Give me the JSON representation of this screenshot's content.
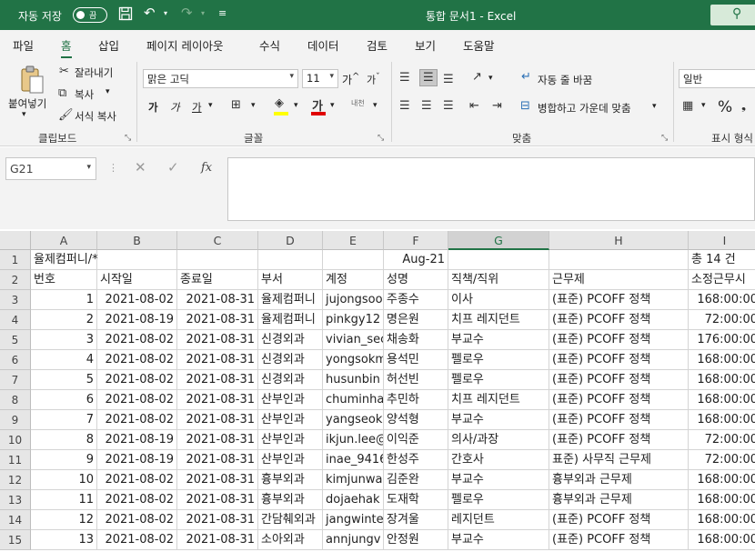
{
  "titlebar": {
    "autosave_label": "자동 저장",
    "autosave_state": "끔",
    "window_title": "통합 문서1  -  Excel"
  },
  "menu_tabs": [
    "파일",
    "홈",
    "삽입",
    "페이지 레이아웃",
    "수식",
    "데이터",
    "검토",
    "보기",
    "도움말"
  ],
  "ribbon": {
    "clipboard": {
      "paste": "붙여넣기",
      "cut": "잘라내기",
      "copy": "복사",
      "format_painter": "서식 복사",
      "group": "클립보드"
    },
    "font": {
      "name": "맑은 고딕",
      "size": "11",
      "bold": "가",
      "italic": "가",
      "underline": "가",
      "grow": "가",
      "shrink": "가",
      "phonetic": "내천",
      "group": "글꼴"
    },
    "alignment": {
      "wrap": "자동 줄 바꿈",
      "merge": "병합하고 가운데 맞춤",
      "group": "맞춤"
    },
    "number": {
      "format": "일반",
      "percent": "%",
      "group": "표시 형식"
    }
  },
  "formula_bar": {
    "name_box": "G21",
    "value": ""
  },
  "sheet": {
    "columns": [
      "A",
      "B",
      "C",
      "D",
      "E",
      "F",
      "G",
      "H",
      "I"
    ],
    "selected_column": "G",
    "row1": {
      "A": "율제컴퍼니/*",
      "F": "Aug-21",
      "I": "총 14 건"
    },
    "headers": [
      "번호",
      "시작일",
      "종료일",
      "부서",
      "계정",
      "성명",
      "직책/직위",
      "근무제",
      "소정근무시"
    ],
    "rows": [
      [
        "1",
        "2021-08-02",
        "2021-08-31",
        "율제컴퍼니",
        "jujongsoo",
        "주종수",
        "이사",
        "(표준) PCOFF 정책",
        "168:00:00"
      ],
      [
        "2",
        "2021-08-19",
        "2021-08-31",
        "율제컴퍼니",
        "pinkgy12",
        "명은원",
        "치프 레지던트",
        "(표준) PCOFF 정책",
        "72:00:00"
      ],
      [
        "3",
        "2021-08-02",
        "2021-08-31",
        "신경외과",
        "vivian_sec",
        "채송화",
        "부교수",
        "(표준) PCOFF 정책",
        "176:00:00"
      ],
      [
        "4",
        "2021-08-02",
        "2021-08-31",
        "신경외과",
        "yongsokm",
        "용석민",
        "펠로우",
        "(표준) PCOFF 정책",
        "168:00:00"
      ],
      [
        "5",
        "2021-08-02",
        "2021-08-31",
        "신경외과",
        "husunbin",
        "허선빈",
        "펠로우",
        "(표준) PCOFF 정책",
        "168:00:00"
      ],
      [
        "6",
        "2021-08-02",
        "2021-08-31",
        "산부인과",
        "chuminha",
        "추민하",
        "치프 레지던트",
        "(표준) PCOFF 정책",
        "168:00:00"
      ],
      [
        "7",
        "2021-08-02",
        "2021-08-31",
        "산부인과",
        "yangseok",
        "양석형",
        "부교수",
        "(표준) PCOFF 정책",
        "168:00:00"
      ],
      [
        "8",
        "2021-08-19",
        "2021-08-31",
        "산부인과",
        "ikjun.lee@",
        "이익준",
        "의사/과장",
        "(표준) PCOFF 정책",
        "72:00:00"
      ],
      [
        "9",
        "2021-08-19",
        "2021-08-31",
        "산부인과",
        "inae_9416",
        "한성주",
        "간호사",
        "표준) 사무직 근무제",
        "72:00:00"
      ],
      [
        "10",
        "2021-08-02",
        "2021-08-31",
        "흉부외과",
        "kimjunwa",
        "김준완",
        "부교수",
        "흉부외과 근무제",
        "168:00:00"
      ],
      [
        "11",
        "2021-08-02",
        "2021-08-31",
        "흉부외과",
        "dojaehak",
        "도재학",
        "펠로우",
        "흉부외과 근무제",
        "168:00:00"
      ],
      [
        "12",
        "2021-08-02",
        "2021-08-31",
        "간담췌외과",
        "jangwinte",
        "장겨울",
        "레지던트",
        "(표준) PCOFF 정책",
        "168:00:00"
      ],
      [
        "13",
        "2021-08-02",
        "2021-08-31",
        "소아외과",
        "annjungv",
        "안정원",
        "부교수",
        "(표준) PCOFF 정책",
        "168:00:00"
      ]
    ]
  }
}
